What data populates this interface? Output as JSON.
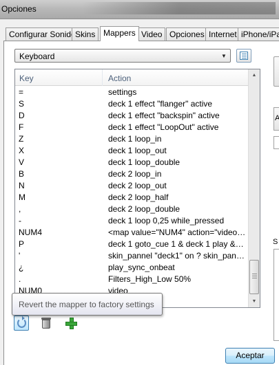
{
  "window": {
    "title": "Opciones"
  },
  "tabs": [
    "Configurar Sonido",
    "Skins",
    "Mappers",
    "Video",
    "Opciones",
    "Internet",
    "iPhone/iPa"
  ],
  "active_tab": "Mappers",
  "mapper_select": {
    "value": "Keyboard"
  },
  "table": {
    "columns": [
      "Key",
      "Action"
    ],
    "rows": [
      {
        "key": "=",
        "action": "settings"
      },
      {
        "key": "S",
        "action": "deck 1 effect \"flanger\" active"
      },
      {
        "key": "D",
        "action": "deck 1 effect \"backspin\" active"
      },
      {
        "key": "F",
        "action": "deck 1 effect \"LoopOut\" active"
      },
      {
        "key": "Z",
        "action": "deck 1 loop_in"
      },
      {
        "key": "X",
        "action": "deck 1 loop_out"
      },
      {
        "key": "V",
        "action": "deck 1 loop_double"
      },
      {
        "key": "B",
        "action": "deck 2 loop_in"
      },
      {
        "key": "N",
        "action": "deck 2 loop_out"
      },
      {
        "key": "M",
        "action": "deck 2 loop_half"
      },
      {
        "key": ",",
        "action": "deck 2 loop_double"
      },
      {
        "key": "-",
        "action": "deck 1 loop 0,25 while_pressed"
      },
      {
        "key": "NUM4",
        "action": "<map value=\"NUM4\" action=\"video_fx..."
      },
      {
        "key": "P",
        "action": "deck 1 goto_cue 1 & deck 1 play & de..."
      },
      {
        "key": "'",
        "action": "skin_pannel \"deck1\" on ? skin_pannel..."
      },
      {
        "key": "¿",
        "action": "play_sync_onbeat"
      },
      {
        "key": ".",
        "action": "Filters_High_Low 50%"
      },
      {
        "key": "NUM0",
        "action": "video"
      }
    ]
  },
  "tooltip": {
    "text": "Revert the mapper to factory settings"
  },
  "buttons": {
    "accept": "Aceptar"
  },
  "side": {
    "label": "S",
    "btn_label": "A"
  }
}
